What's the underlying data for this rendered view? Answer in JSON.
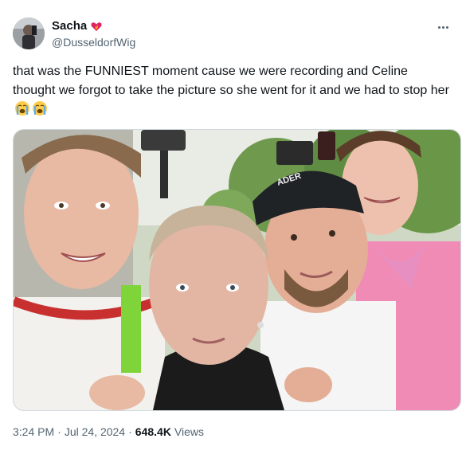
{
  "author": {
    "display_name": "Sacha",
    "handle": "@DusseldorfWig",
    "badge_icon": "heart-fire-icon"
  },
  "menu": {
    "icon": "more-icon"
  },
  "tweet": {
    "text": "that was the FUNNIEST moment cause we were recording and Celine thought we forgot to take the picture so she went for it and we had to stop her",
    "emojis": [
      "😭",
      "😭"
    ]
  },
  "media": {
    "cap_text": "ADER",
    "description_icon": "photo-icon"
  },
  "footer": {
    "time": "3:24 PM",
    "sep1": "·",
    "date": "Jul 24, 2024",
    "sep2": "·",
    "views_count": "648.4K",
    "views_label": "Views"
  },
  "colors": {
    "text_primary": "#0f1419",
    "text_secondary": "#536471",
    "border": "#cfd9de"
  }
}
